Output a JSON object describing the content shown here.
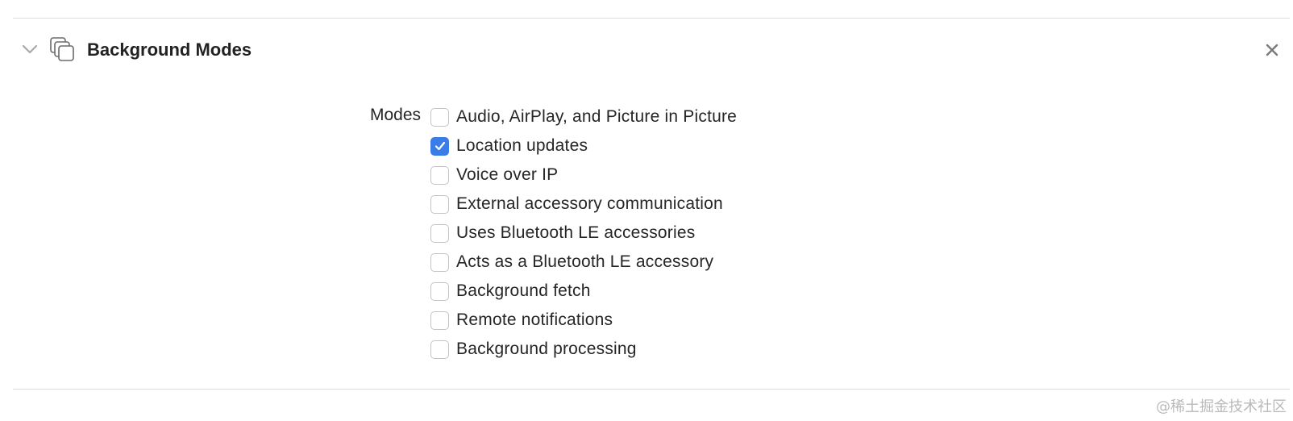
{
  "section": {
    "title": "Background Modes",
    "collapse_icon": "chevron-down-icon",
    "capability_icon": "background-modes-icon",
    "close_icon": "close-icon"
  },
  "modes": {
    "label": "Modes",
    "items": [
      {
        "label": "Audio, AirPlay, and Picture in Picture",
        "checked": false
      },
      {
        "label": "Location updates",
        "checked": true
      },
      {
        "label": "Voice over IP",
        "checked": false
      },
      {
        "label": "External accessory communication",
        "checked": false
      },
      {
        "label": "Uses Bluetooth LE accessories",
        "checked": false
      },
      {
        "label": "Acts as a Bluetooth LE accessory",
        "checked": false
      },
      {
        "label": "Background fetch",
        "checked": false
      },
      {
        "label": "Remote notifications",
        "checked": false
      },
      {
        "label": "Background processing",
        "checked": false
      }
    ]
  },
  "watermark": "@稀土掘金技术社区",
  "colors": {
    "accent": "#3b7de8",
    "divider": "#dcdcdc"
  }
}
